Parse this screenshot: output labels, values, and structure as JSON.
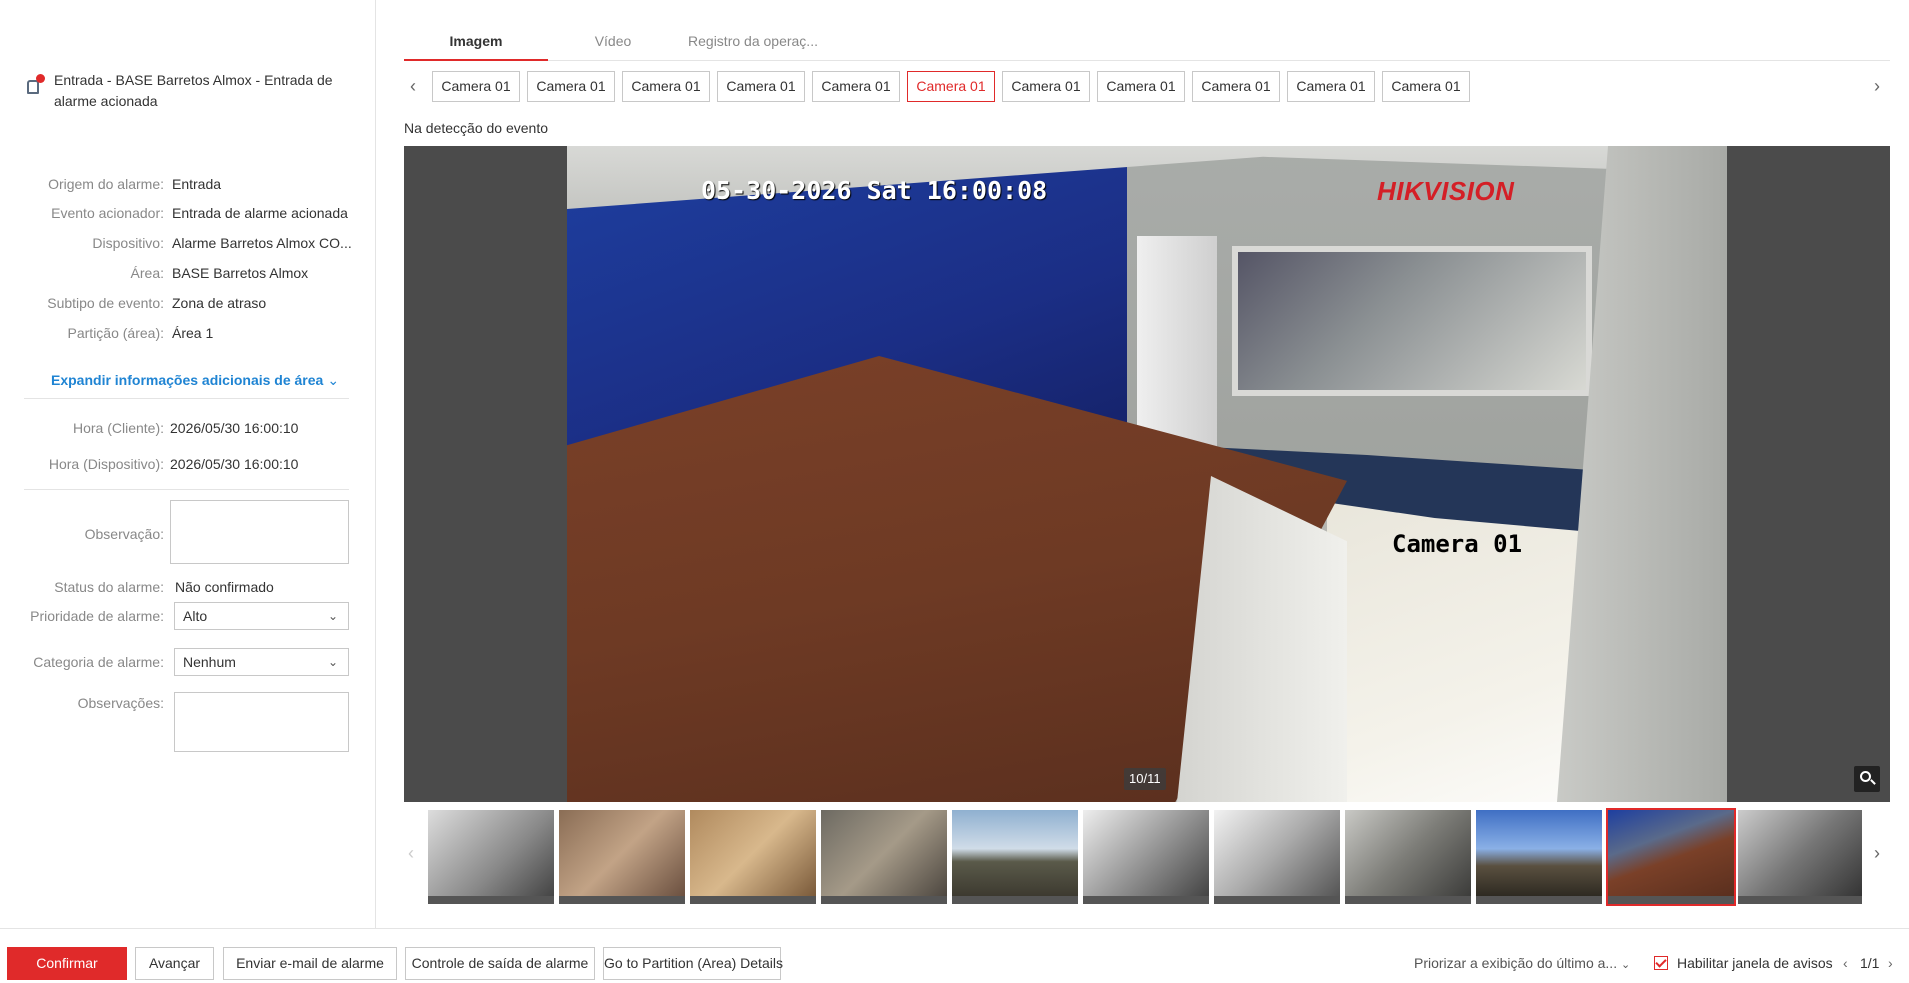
{
  "header": {
    "title": "Entrada - BASE Barretos Almox - Entrada de alarme acionada",
    "icon": "alarm-bell-icon"
  },
  "info": [
    {
      "label": "Origem do alarme:",
      "value": "Entrada"
    },
    {
      "label": "Evento acionador:",
      "value": "Entrada de alarme acionada"
    },
    {
      "label": "Dispositivo:",
      "value": "Alarme Barretos Almox CO..."
    },
    {
      "label": "Área:",
      "value": "BASE Barretos Almox"
    },
    {
      "label": "Subtipo de evento:",
      "value": "Zona de atraso"
    },
    {
      "label": "Partição (área):",
      "value": "Área 1"
    }
  ],
  "expand_label": "Expandir informações adicionais de área",
  "time": [
    {
      "label": "Hora (Cliente):",
      "value": "2026/05/30 16:00:10"
    },
    {
      "label": "Hora (Dispositivo):",
      "value": "2026/05/30 16:00:10"
    }
  ],
  "form": {
    "observacao_label": "Observação:",
    "status_label": "Status do alarme:",
    "status_value": "Não confirmado",
    "prioridade_label": "Prioridade de alarme:",
    "prioridade_value": "Alto",
    "categoria_label": "Categoria de alarme:",
    "categoria_value": "Nenhum",
    "observacoes_label": "Observações:"
  },
  "tabs": [
    "Imagem",
    "Vídeo",
    "Registro da operaç..."
  ],
  "active_tab": 0,
  "cameras": [
    "Camera 01",
    "Camera 01",
    "Camera 01",
    "Camera 01",
    "Camera 01",
    "Camera 01",
    "Camera 01",
    "Camera 01",
    "Camera 01",
    "Camera 01",
    "Camera 01"
  ],
  "active_camera": 5,
  "caption": "Na detecção do evento",
  "osd": {
    "timestamp": "05-30-2026 Sat 16:00:08",
    "brand_hik": "HIK",
    "brand_vision": "VISION",
    "camera_name": "Camera 01"
  },
  "counter": "10/11",
  "thumbnails": {
    "count": 11,
    "active": 9
  },
  "bottom": {
    "confirm": "Confirmar",
    "next": "Avançar",
    "email": "Enviar e-mail de alarme",
    "output": "Controle de saída de alarme",
    "partition": "Go to Partition (Area) Details",
    "priority_display": "Priorizar a exibição do último a...",
    "enable_popup": "Habilitar janela de avisos",
    "page": "1/1"
  },
  "colors": {
    "accent": "#e02a2a",
    "link": "#1f84d3"
  }
}
